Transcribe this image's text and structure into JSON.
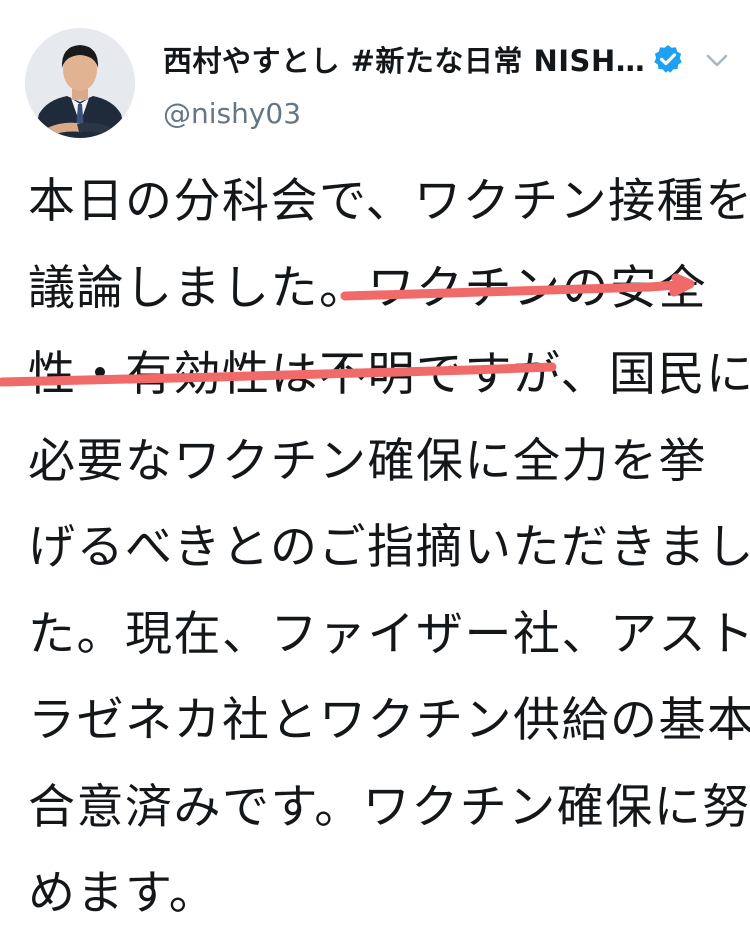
{
  "tweet": {
    "display_name": "西村やすとし #新たな日常 NISH…",
    "handle": "@nishy03",
    "body_lines": [
      "本日の分科会で、ワクチン接種を",
      "議論しました。ワクチンの安全",
      "性・有効性は不明ですが、国民に",
      "必要なワクチン確保に全力を挙",
      "げるべきとのご指摘いただきまし",
      "た。現在、ファイザー社、アスト",
      "ラゼネカ社とワクチン供給の基本",
      "合意済みです。ワクチン確保に努",
      "めます。"
    ]
  },
  "icons": {
    "verified": "verified-badge-icon",
    "menu": "chevron-down-icon"
  },
  "colors": {
    "text": "#14171a",
    "handle": "#657786",
    "verified_badge": "#1da1f2",
    "chevron": "#aab8c2",
    "highlight_stroke": "#f06a6a"
  }
}
